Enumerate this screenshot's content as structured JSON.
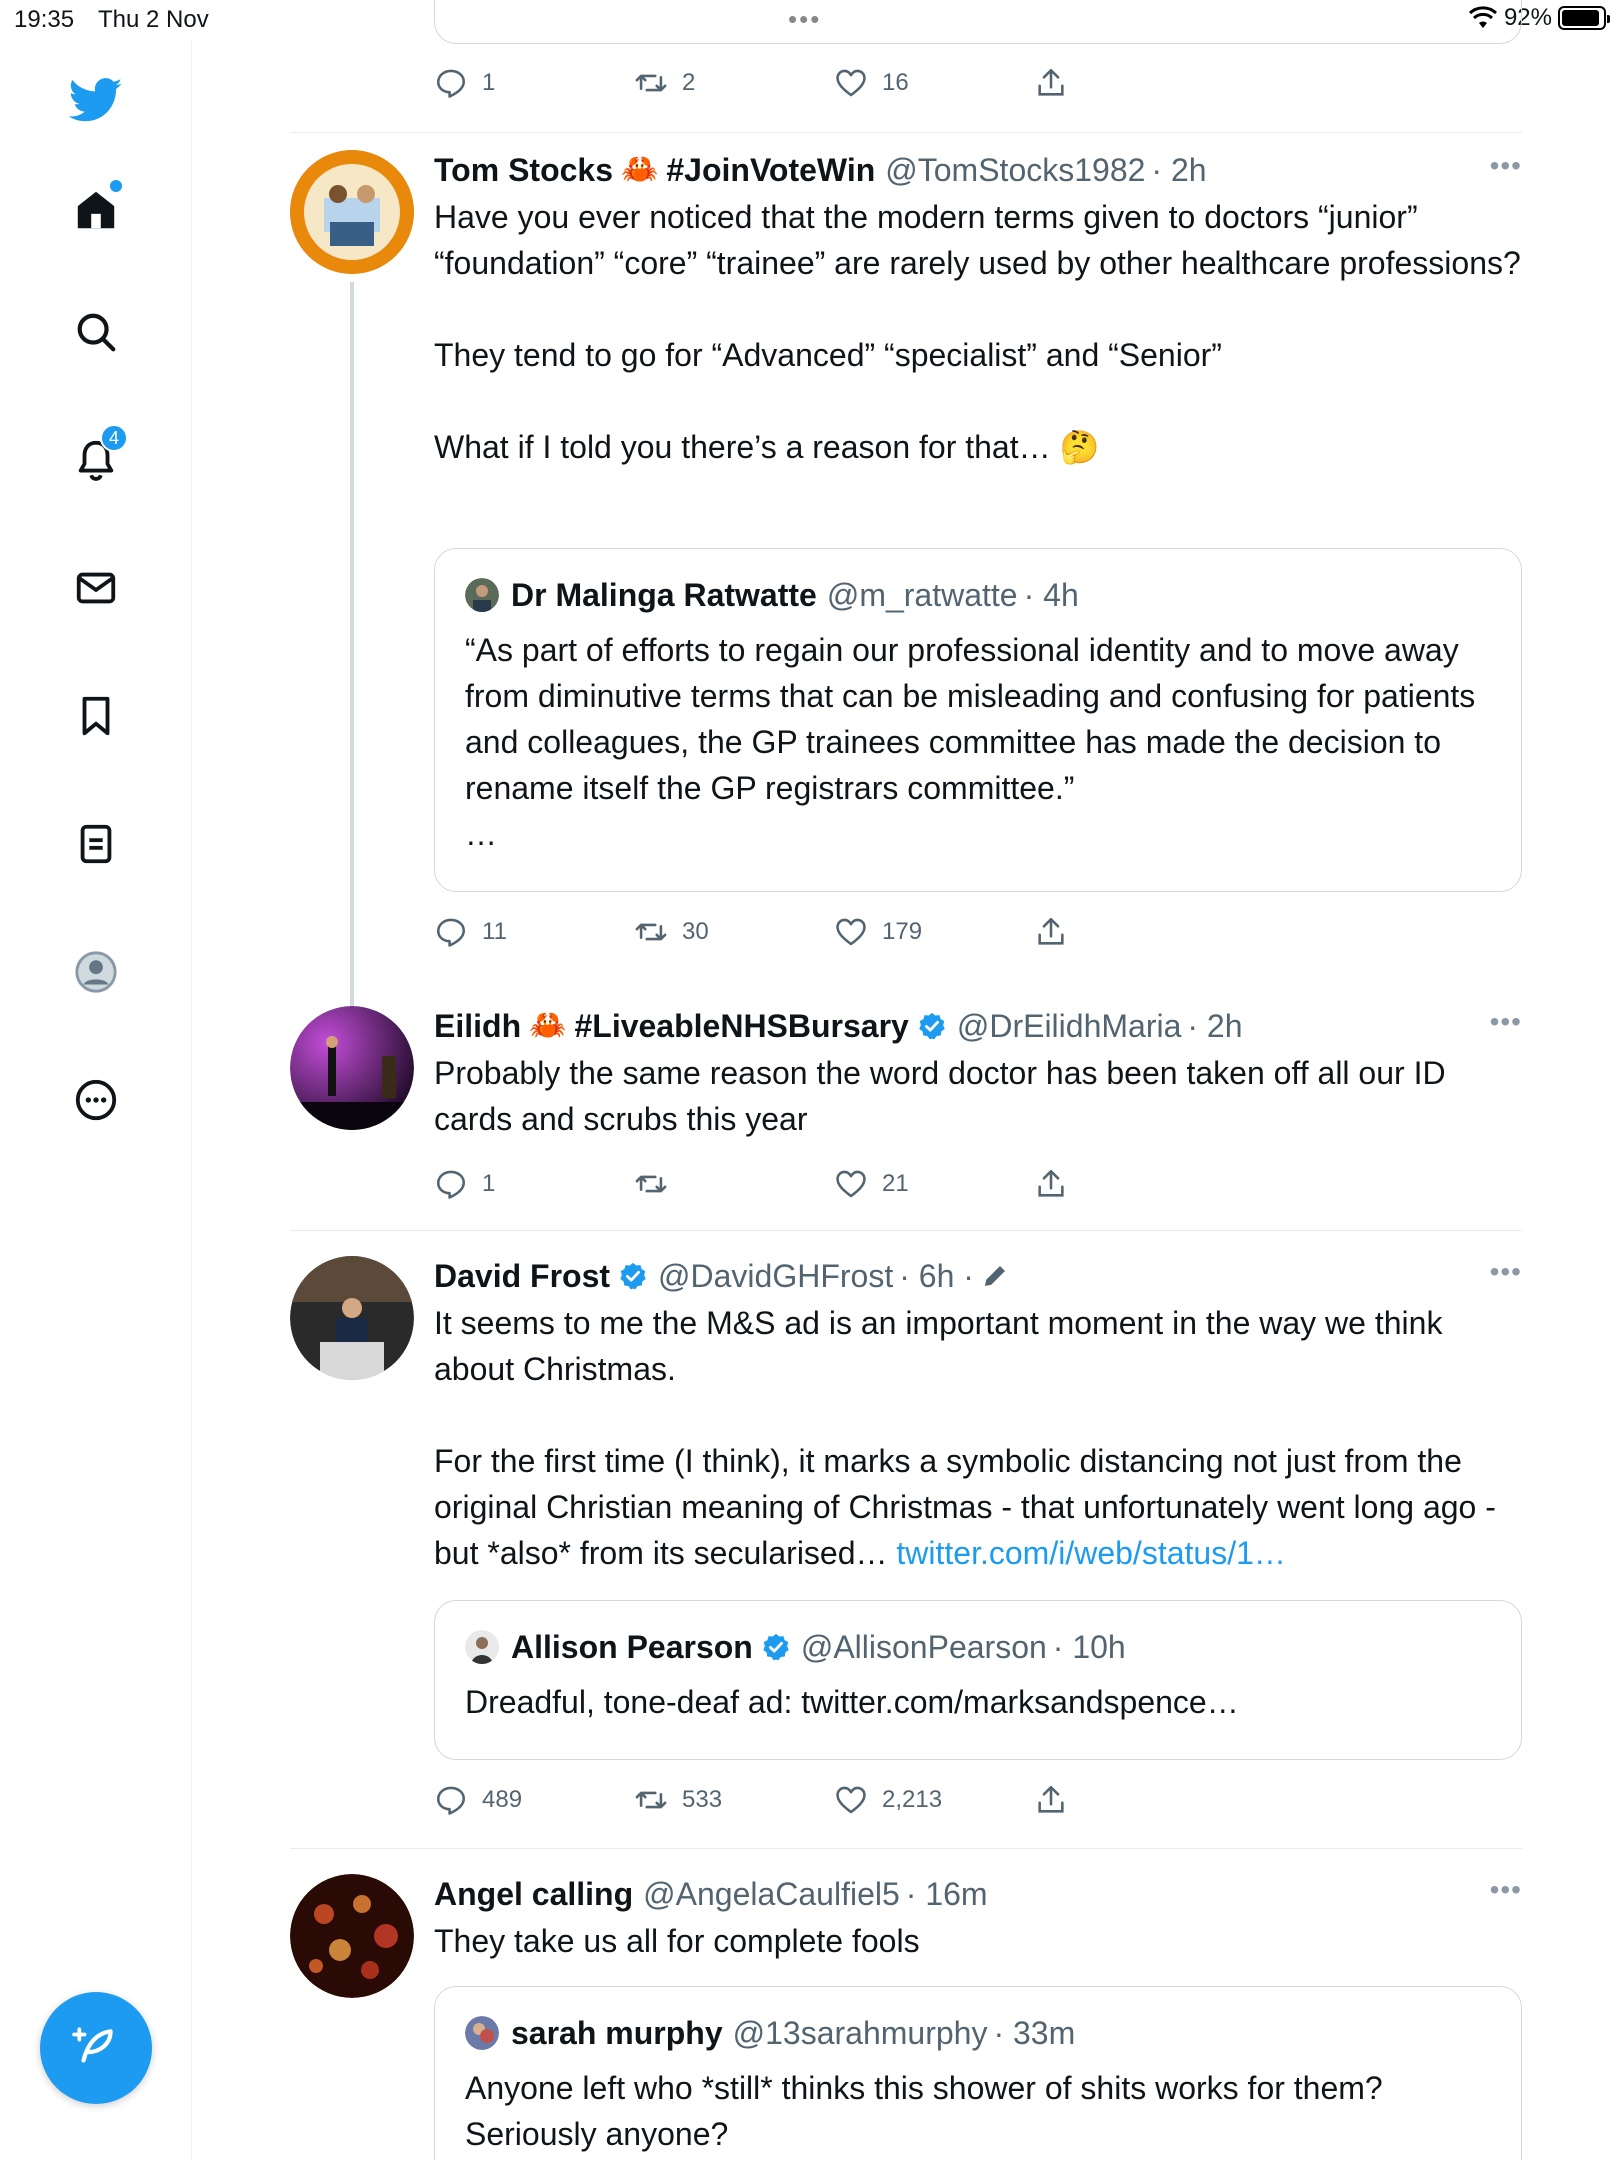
{
  "status_bar": {
    "time": "19:35",
    "date": "Thu 2 Nov",
    "battery": "92%",
    "battery_level": 0.92
  },
  "sidebar": {
    "notifications_badge": "4"
  },
  "top_actions": {
    "replies": "1",
    "retweets": "2",
    "likes": "16"
  },
  "tweets": [
    {
      "name": "Tom Stocks",
      "name_suffix": "#JoinVoteWin",
      "handle": "@TomStocks1982",
      "time": "· 2h",
      "more": "•••",
      "text": "Have you ever noticed that the modern terms given to doctors “junior” “foundation” “core” “trainee” are rarely used by other healthcare professions?\n\nThey tend to go for “Advanced” “specialist” and “Senior”\n\nWhat if I told you there’s a reason for that… 🤔",
      "quote": {
        "name": "Dr Malinga Ratwatte",
        "handle": "@m_ratwatte",
        "time": "· 4h",
        "text": "“As part of efforts to regain our professional identity and to move away from diminutive terms that can be misleading and confusing for patients and colleagues, the GP trainees committee has made the decision to rename itself the GP registrars committee.”\n…"
      },
      "replies": "11",
      "retweets": "30",
      "likes": "179"
    },
    {
      "name": "Eilidh",
      "name_suffix": "#LiveableNHSBursary",
      "handle": "@DrEilidhMaria",
      "time": "· 2h",
      "more": "•••",
      "text": "Probably the same reason the word doctor has been taken off all our ID cards and scrubs this year",
      "replies": "1",
      "retweets": "",
      "likes": "21"
    },
    {
      "name": "David Frost",
      "handle": "@DavidGHFrost",
      "time": "· 6h ·",
      "more": "•••",
      "text": "It seems to me the M&S ad is an important moment in the way we think about Christmas.\n\nFor the first time (I think), it marks a symbolic distancing not just from the original Christian meaning of Christmas - that unfortunately went long ago - but *also* from its secularised… ",
      "link": "twitter.com/i/web/status/1…",
      "quote": {
        "name": "Allison Pearson",
        "handle": "@AllisonPearson",
        "time": "· 10h",
        "text": "Dreadful, tone-deaf ad: twitter.com/marksandspence…"
      },
      "replies": "489",
      "retweets": "533",
      "likes": "2,213"
    },
    {
      "name": "Angel calling",
      "handle": "@AngelaCaulfiel5",
      "time": "· 16m",
      "more": "•••",
      "text": "They take us all for complete fools",
      "quote": {
        "name": "sarah murphy",
        "handle": "@13sarahmurphy",
        "time": "· 33m",
        "text": "Anyone left who *still* thinks this shower of shits works for them? Seriously anyone?"
      }
    }
  ],
  "colors": {
    "accent": "#1d9bf0",
    "text": "#0f1419",
    "muted": "#536471"
  }
}
